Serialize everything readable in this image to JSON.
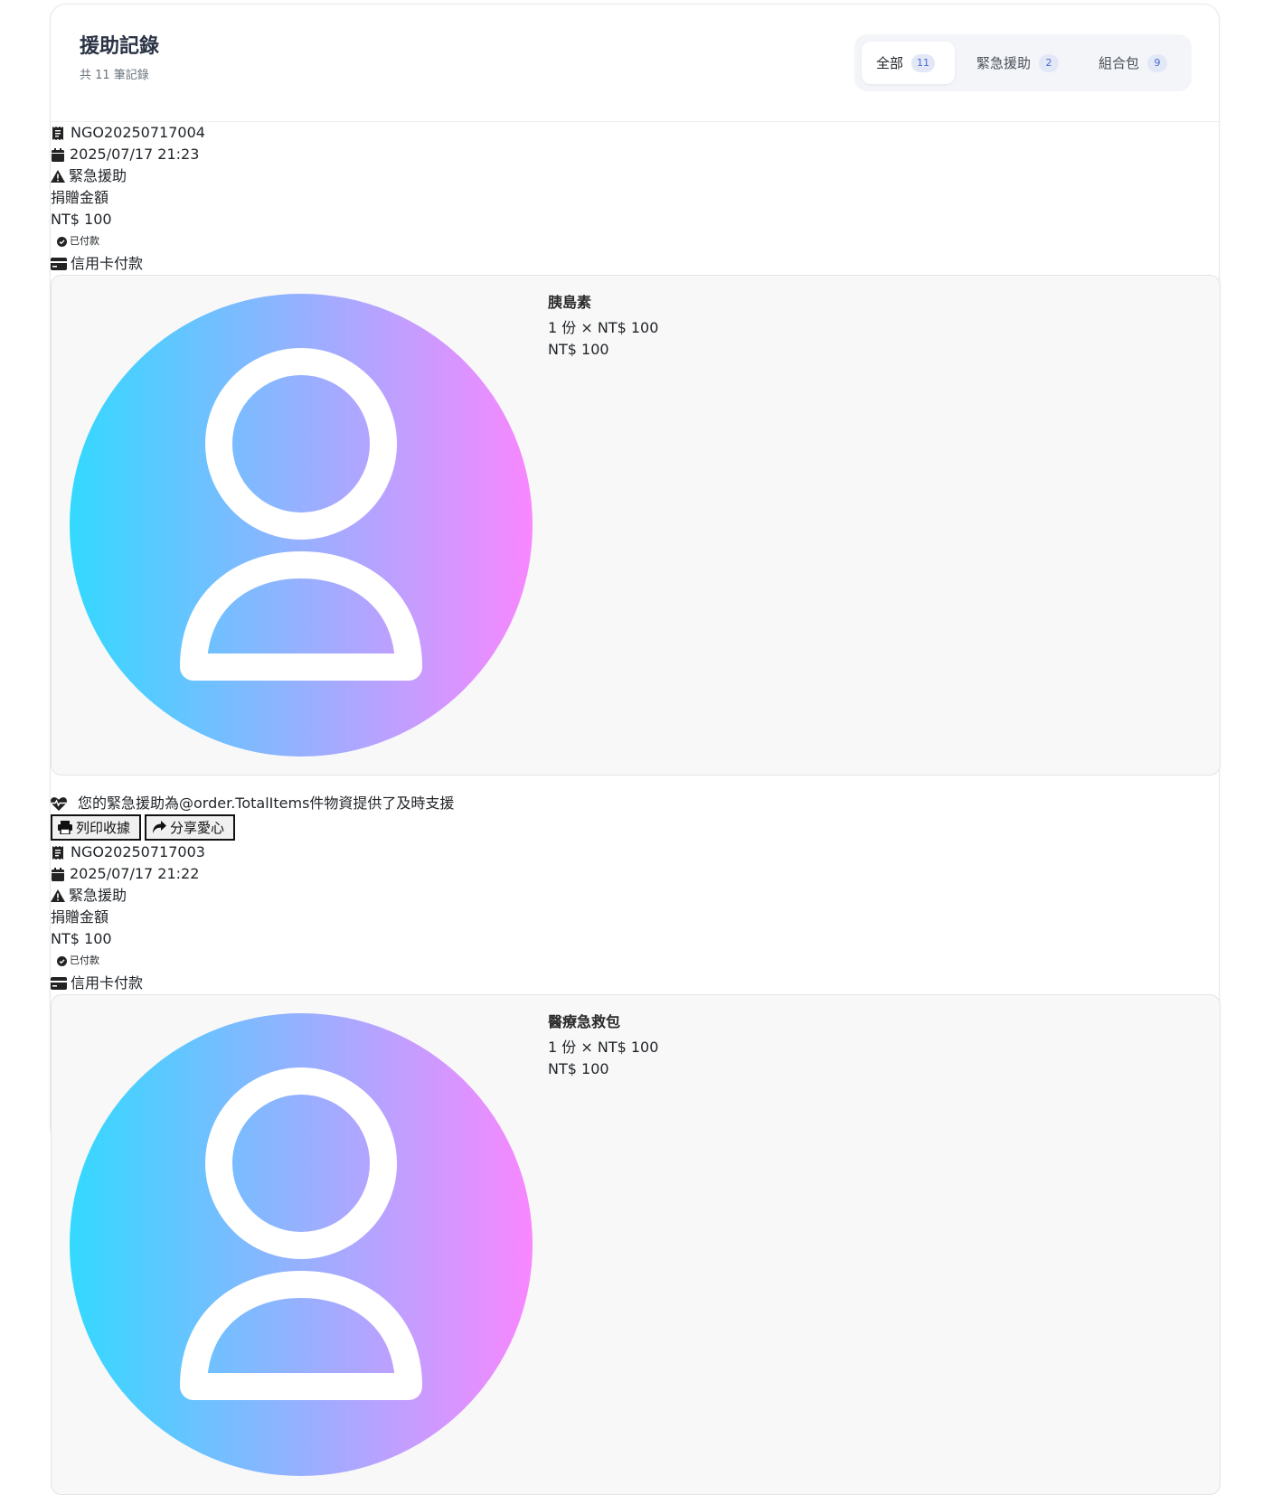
{
  "header": {
    "title": "援助記錄",
    "subtitle": "共 11 筆記錄"
  },
  "tabs": [
    {
      "label": "全部",
      "count": "11",
      "active": true
    },
    {
      "label": "緊急援助",
      "count": "2",
      "active": false
    },
    {
      "label": "組合包",
      "count": "9",
      "active": false
    }
  ],
  "records": [
    {
      "order_no": "NGO20250717004",
      "datetime": "2025/07/17 21:23",
      "type": "緊急援助",
      "amount_label": "捐贈金額",
      "amount": "NT$ 100",
      "payment_status": "已付款",
      "payment_method": "信用卡付款",
      "item": {
        "name": "胰島素",
        "qty_line": "1 份 × NT$ 100",
        "total": "NT$ 100"
      },
      "message": "您的緊急援助為@order.TotalItems件物資提供了及時支援",
      "print_label": "列印收據",
      "share_label": "分享愛心"
    },
    {
      "order_no": "NGO20250717003",
      "datetime": "2025/07/17 21:22",
      "type": "緊急援助",
      "amount_label": "捐贈金額",
      "amount": "NT$ 100",
      "payment_status": "已付款",
      "payment_method": "信用卡付款",
      "item": {
        "name": "醫療急救包",
        "qty_line": "1 份 × NT$ 100",
        "total": "NT$ 100"
      }
    }
  ],
  "colors": {
    "gradient_start": "#33d9ff",
    "gradient_end": "#f987ff",
    "badge_bg": "#e3e8f7",
    "badge_text": "#4a6bd1"
  },
  "icons": {
    "receipt": "receipt-icon",
    "calendar": "calendar-icon",
    "warning": "warning-icon",
    "check": "check-circle-icon",
    "card": "credit-card-icon",
    "heart": "heartbeat-icon",
    "print": "printer-icon",
    "share": "share-icon",
    "avatar": "user-avatar-icon"
  }
}
